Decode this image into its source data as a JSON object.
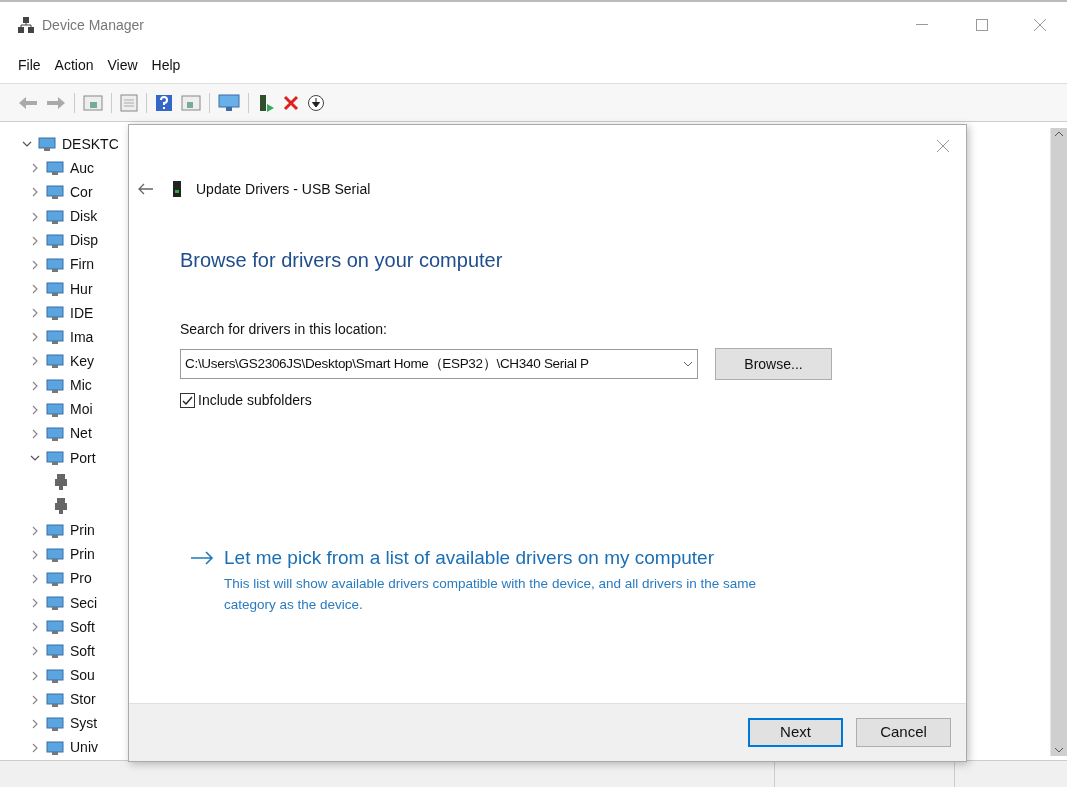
{
  "window": {
    "title": "Device Manager"
  },
  "menu": [
    "File",
    "Action",
    "View",
    "Help"
  ],
  "tree": {
    "label": "DESKTC",
    "expanded": true,
    "children": [
      {
        "label": "Auc",
        "expanded": false
      },
      {
        "label": "Cor",
        "expanded": false
      },
      {
        "label": "Disk",
        "expanded": false
      },
      {
        "label": "Disp",
        "expanded": false
      },
      {
        "label": "Firn",
        "expanded": false
      },
      {
        "label": "Hur",
        "expanded": false
      },
      {
        "label": "IDE",
        "expanded": false
      },
      {
        "label": "Ima",
        "expanded": false
      },
      {
        "label": "Key",
        "expanded": false
      },
      {
        "label": "Mic",
        "expanded": false
      },
      {
        "label": "Moi",
        "expanded": false
      },
      {
        "label": "Net",
        "expanded": false
      },
      {
        "label": "Port",
        "expanded": true,
        "children": [
          {
            "kind": "port"
          },
          {
            "kind": "port"
          }
        ]
      },
      {
        "label": "Prin",
        "expanded": false
      },
      {
        "label": "Prin",
        "expanded": false
      },
      {
        "label": "Pro",
        "expanded": false
      },
      {
        "label": "Seci",
        "expanded": false
      },
      {
        "label": "Soft",
        "expanded": false
      },
      {
        "label": "Soft",
        "expanded": false
      },
      {
        "label": "Sou",
        "expanded": false
      },
      {
        "label": "Stor",
        "expanded": false
      },
      {
        "label": "Syst",
        "expanded": false
      },
      {
        "label": "Univ",
        "expanded": false
      }
    ]
  },
  "dialog": {
    "title": "Update Drivers - USB Serial",
    "heading": "Browse for drivers on your computer",
    "location_label": "Search for drivers in this location:",
    "location_value": "C:\\Users\\GS2306JS\\Desktop\\Smart Home（ESP32）\\CH340 Serial P",
    "browse_button": "Browse...",
    "include_subfolders": {
      "label": "Include subfolders",
      "checked": true
    },
    "pick_link": "Let me pick from a list of available drivers on my computer",
    "pick_description": "This list will show available drivers compatible with the device, and all drivers in the same category as the device.",
    "buttons": [
      {
        "label": "Next",
        "selected": true
      },
      {
        "label": "Cancel",
        "selected": false
      }
    ]
  }
}
